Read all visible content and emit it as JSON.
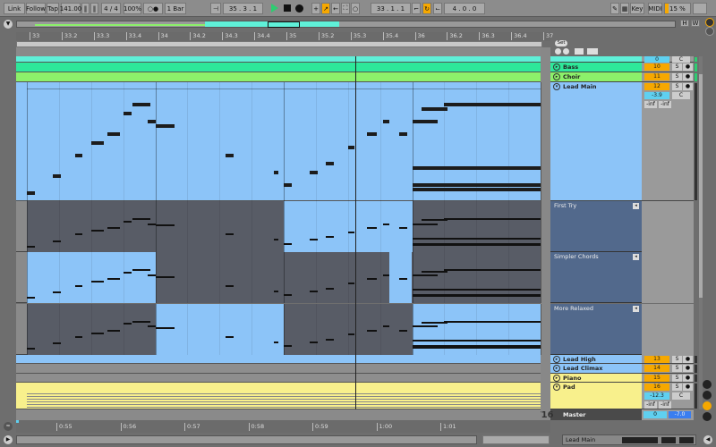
{
  "toolbar": {
    "link": "Link",
    "follow": "Follow",
    "tap": "Tap",
    "tempo": "141.00",
    "signature": "4 / 4",
    "zoom": "100%",
    "metro": "○●",
    "quantize": "1 Bar",
    "position": "35 .  3 .  1",
    "loop_start": "33 .  1 .  1",
    "loop_length": "4 .  0 .  0",
    "key": "Key",
    "midi": "MIDI",
    "cpu": "15 %",
    "colors": {
      "play": "#2ecc71",
      "accent": "#f6a800"
    }
  },
  "overview": {
    "h": "H",
    "w": "W"
  },
  "ruler": {
    "ticks": [
      "33",
      "33.2",
      "33.3",
      "33.4",
      "34",
      "34.2",
      "34.3",
      "34.4",
      "35",
      "35.2",
      "35.3",
      "35.4",
      "36",
      "36.2",
      "36.3",
      "36.4",
      "37"
    ],
    "set": "Set"
  },
  "tracks": [
    {
      "name": "",
      "num": "0",
      "pan": "C",
      "color": "#5ff0d8"
    },
    {
      "name": "Bass",
      "num": "10",
      "s": "S",
      "color": "#2ee89a"
    },
    {
      "name": "Choir",
      "num": "11",
      "s": "S",
      "color": "#8cf06a"
    },
    {
      "name": "Lead Main",
      "num": "12",
      "s": "S",
      "vol": "-3.9",
      "pan": "C",
      "send_a": "-inf",
      "send_b": "-inf",
      "color": "#8cc4f8"
    },
    {
      "name": "Lead High",
      "num": "13",
      "s": "S",
      "color": "#8cc4f8"
    },
    {
      "name": "Lead Climax",
      "num": "14",
      "s": "S",
      "color": "#8cc4f8"
    },
    {
      "name": "Piano",
      "num": "15",
      "s": "S",
      "color": "#f8f08c"
    },
    {
      "name": "Pad",
      "num": "16",
      "s": "S",
      "vol": "-12.3",
      "pan": "C",
      "send_a": "-inf",
      "send_b": "-inf",
      "color": "#f8f08c"
    }
  ],
  "take_lanes": [
    {
      "name": "First Try"
    },
    {
      "name": "Simpler Chords"
    },
    {
      "name": "More Relaxed"
    }
  ],
  "master": {
    "name": "Master",
    "vol": "0",
    "pan": "-7.0"
  },
  "grid_label": "1/16",
  "time_ruler": [
    "0:55",
    "0:56",
    "0:57",
    "0:58",
    "0:59",
    "1:00",
    "1:01"
  ],
  "bottom": {
    "selected_track": "Lead Main"
  },
  "notes_lead_main": [
    [
      0,
      0.25,
      61
    ],
    [
      0.8,
      0.25,
      65
    ],
    [
      1.5,
      0.22,
      70
    ],
    [
      2,
      0.4,
      73
    ],
    [
      2.5,
      0.4,
      75
    ],
    [
      3,
      0.25,
      80
    ],
    [
      3.3,
      0.55,
      82
    ],
    [
      3.75,
      0.25,
      78
    ],
    [
      4,
      0.6,
      77
    ],
    [
      6.2,
      0.25,
      70
    ],
    [
      7.7,
      0.12,
      66
    ],
    [
      8,
      0.25,
      63
    ],
    [
      8.8,
      0.25,
      66
    ],
    [
      9.3,
      0.25,
      68
    ],
    [
      10,
      0.2,
      72
    ],
    [
      10.6,
      0.3,
      75
    ],
    [
      11.1,
      0.2,
      78
    ],
    [
      11.6,
      0.25,
      75
    ],
    [
      12,
      0.8,
      78
    ],
    [
      12.3,
      0.8,
      81
    ],
    [
      13,
      3,
      82
    ],
    [
      12,
      4,
      67
    ],
    [
      12,
      4,
      63
    ],
    [
      12,
      4,
      62
    ]
  ]
}
